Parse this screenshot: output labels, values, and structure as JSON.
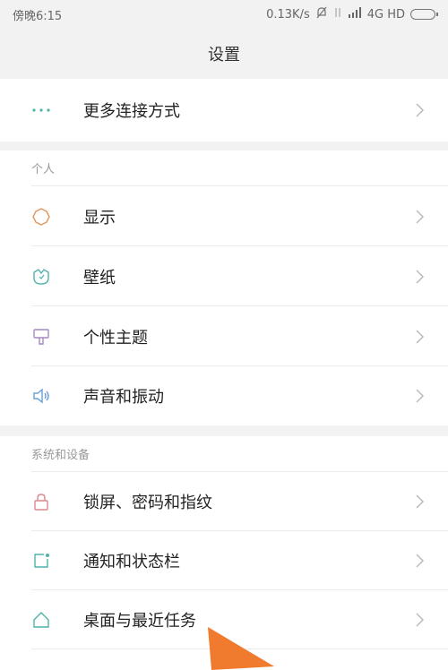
{
  "status": {
    "time": "傍晚6:15",
    "speed": "0.13K/s",
    "network": "4G HD"
  },
  "header": {
    "title": "设置"
  },
  "rows": {
    "more_connections": "更多连接方式",
    "display": "显示",
    "wallpaper": "壁纸",
    "theme": "个性主题",
    "sound": "声音和振动",
    "lockscreen": "锁屏、密码和指纹",
    "notifications": "通知和状态栏",
    "desktop": "桌面与最近任务"
  },
  "sections": {
    "personal": "个人",
    "system": "系统和设备"
  },
  "colors": {
    "teal": "#4fb3a9",
    "orange": "#e0955a",
    "red": "#d98a8f",
    "purple": "#a48ac0",
    "blue": "#6a9fd6",
    "arrow": "#f07a2e"
  }
}
